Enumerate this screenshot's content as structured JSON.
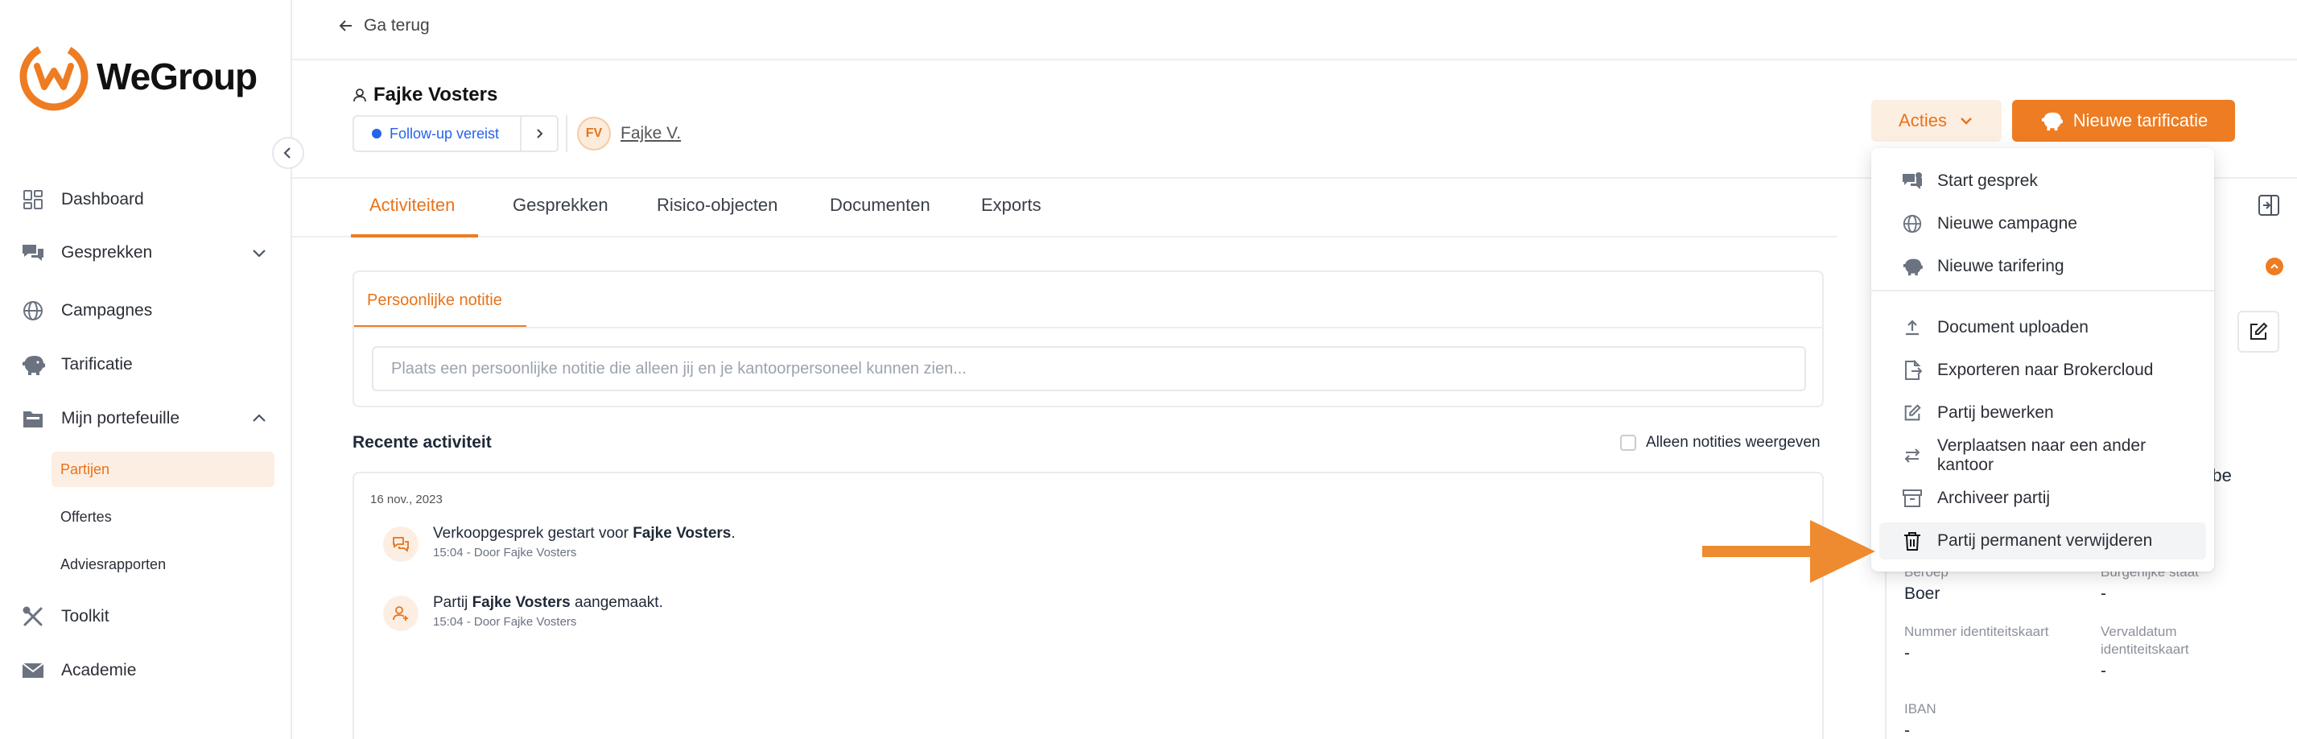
{
  "app": {
    "brand": "WeGroup",
    "accent": "#ee7c22"
  },
  "sidebar": {
    "items": [
      {
        "label": "Dashboard",
        "icon": "grid-icon"
      },
      {
        "label": "Gesprekken",
        "icon": "chat-icon"
      },
      {
        "label": "Campagnes",
        "icon": "globe-icon"
      },
      {
        "label": "Tarificatie",
        "icon": "piggybank-icon"
      },
      {
        "label": "Mijn portefeuille",
        "icon": "folder-icon"
      },
      {
        "label": "Toolkit",
        "icon": "tools-icon"
      },
      {
        "label": "Academie",
        "icon": "academy-icon"
      }
    ],
    "subitems": [
      {
        "label": "Partijen",
        "active": true
      },
      {
        "label": "Offertes",
        "active": false
      },
      {
        "label": "Adviesrapporten",
        "active": false
      }
    ]
  },
  "topbar": {
    "back_label": "Ga terug"
  },
  "header": {
    "name": "Fajke Vosters",
    "followup": "Follow-up vereist",
    "owner_initials": "FV",
    "owner_name": "Fajke V.",
    "acties_label": "Acties",
    "new_label": "Nieuwe tarificatie"
  },
  "tabs": [
    "Activiteiten",
    "Gesprekken",
    "Risico-objecten",
    "Documenten",
    "Exports"
  ],
  "note": {
    "tab_label": "Persoonlijke notitie",
    "placeholder": "Plaats een persoonlijke notitie die alleen jij en je kantoorpersoneel kunnen zien..."
  },
  "recent": {
    "title": "Recente activiteit",
    "filter_label": "Alleen notities weergeven",
    "date": "16 nov., 2023",
    "items": [
      {
        "pre": "Verkoopgesprek gestart voor ",
        "bold": "Fajke Vosters",
        "post": ".",
        "meta": "15:04 - Door Fajke Vosters"
      },
      {
        "pre": "Partij ",
        "bold": "Fajke Vosters",
        "post": " aangemaakt.",
        "meta": "15:04 - Door Fajke Vosters"
      }
    ]
  },
  "dropdown": {
    "items": [
      {
        "label": "Start gesprek",
        "icon": "chat-plus-icon"
      },
      {
        "label": "Nieuwe campagne",
        "icon": "globe-icon"
      },
      {
        "label": "Nieuwe tarifering",
        "icon": "piggybank-icon"
      },
      {
        "label": "Document uploaden",
        "icon": "upload-icon"
      },
      {
        "label": "Exporteren naar Brokercloud",
        "icon": "export-file-icon"
      },
      {
        "label": "Partij bewerken",
        "icon": "edit-icon"
      },
      {
        "label": "Verplaatsen naar een ander kantoor",
        "icon": "swap-icon"
      },
      {
        "label": "Archiveer partij",
        "icon": "archive-icon"
      },
      {
        "label": "Partij permanent verwijderen",
        "icon": "trash-icon"
      }
    ]
  },
  "panel": {
    "email_fragment": "o.be",
    "fields": [
      {
        "label": "Beroep",
        "value": "Boer"
      },
      {
        "label": "Burgerlijke staat",
        "value": "-"
      },
      {
        "label": "Nummer identiteitskaart",
        "value": "-"
      },
      {
        "label": "Vervaldatum identiteitskaart",
        "value": "-"
      },
      {
        "label": "IBAN",
        "value": "-"
      }
    ]
  }
}
